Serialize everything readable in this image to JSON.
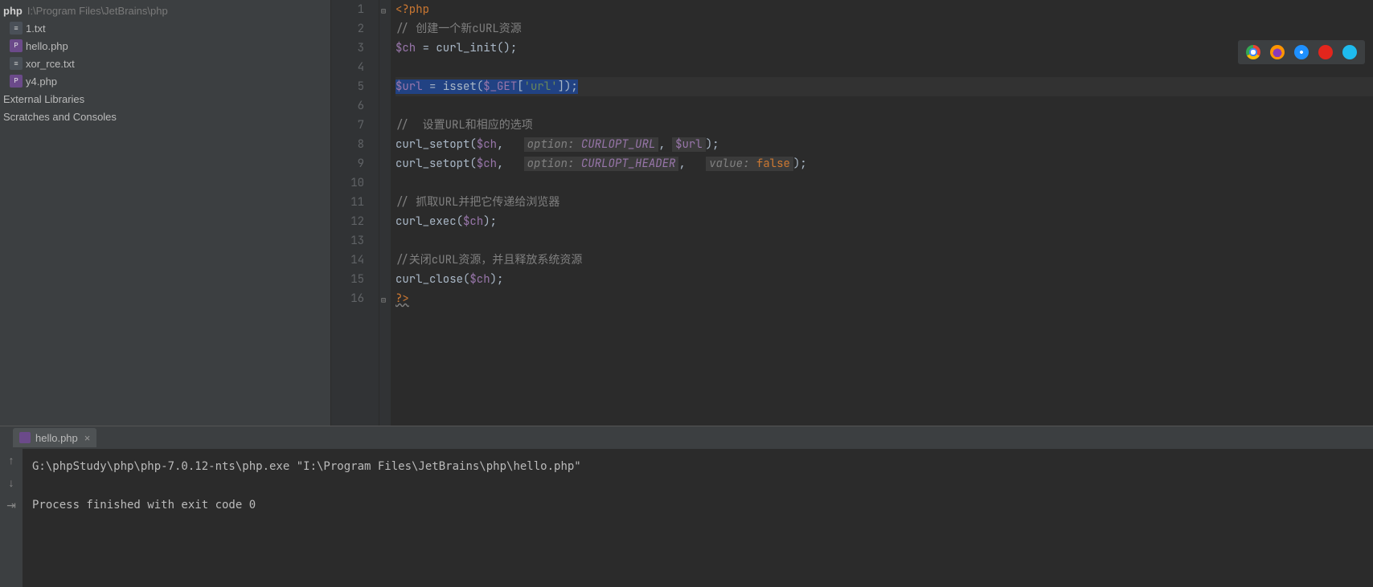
{
  "project": {
    "name": "php",
    "path": "I:\\Program Files\\JetBrains\\php",
    "files": [
      {
        "name": "1.txt",
        "type": "txt"
      },
      {
        "name": "hello.php",
        "type": "php"
      },
      {
        "name": "xor_rce.txt",
        "type": "txt"
      },
      {
        "name": "y4.php",
        "type": "php"
      }
    ],
    "extra_nodes": [
      "External Libraries",
      "Scratches and Consoles"
    ]
  },
  "editor": {
    "line_numbers": [
      "1",
      "2",
      "3",
      "4",
      "5",
      "6",
      "7",
      "8",
      "9",
      "10",
      "11",
      "12",
      "13",
      "14",
      "15",
      "16"
    ],
    "lines": {
      "l1_open": "<?php",
      "l2_comment": "// 创建一个新cURL资源",
      "l3_var": "$ch",
      "l3_eq": " = ",
      "l3_fn": "curl_init",
      "l3_rest": "();",
      "l5_var": "$url",
      "l5_eq": " = ",
      "l5_fn": "isset",
      "l5_op1": "(",
      "l5_get": "$_GET",
      "l5_br1": "[",
      "l5_str": "'url'",
      "l5_br2": "]);",
      "l7_comment": "//  设置URL和相应的选项",
      "l8_fn": "curl_setopt",
      "l8_p1": "(",
      "l8_var": "$ch",
      "l8_c1": ", ",
      "l8_hint": "option:",
      "l8_const": " CURLOPT_URL",
      "l8_c2": ", ",
      "l8_var2": "$url",
      "l8_end": ");",
      "l9_fn": "curl_setopt",
      "l9_p1": "(",
      "l9_var": "$ch",
      "l9_c1": ", ",
      "l9_hint1": "option:",
      "l9_const": " CURLOPT_HEADER",
      "l9_c2": ", ",
      "l9_hint2": "value:",
      "l9_val": " false",
      "l9_end": ");",
      "l11_comment": "// 抓取URL并把它传递给浏览器",
      "l12_fn": "curl_exec",
      "l12_p1": "(",
      "l12_var": "$ch",
      "l12_end": ");",
      "l14_comment": "//关闭cURL资源，并且释放系统资源",
      "l15_fn": "curl_close",
      "l15_p1": "(",
      "l15_var": "$ch",
      "l15_end": ");",
      "l16_close": "?>"
    }
  },
  "run": {
    "tab": "hello.php",
    "output_line1": "G:\\phpStudy\\php\\php-7.0.12-nts\\php.exe \"I:\\Program Files\\JetBrains\\php\\hello.php\"",
    "output_line2": "Process finished with exit code 0"
  },
  "browsers": [
    "chrome",
    "firefox",
    "safari",
    "opera",
    "ie"
  ]
}
